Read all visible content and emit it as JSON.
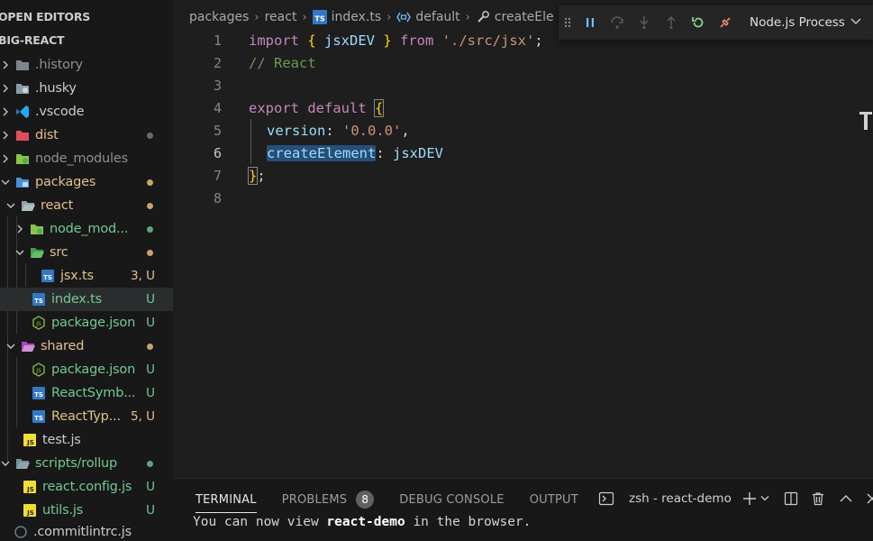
{
  "sidebar": {
    "open_editors": "OPEN EDITORS",
    "project": "BIG-REACT",
    "items": [
      {
        "label": ".history",
        "status": ""
      },
      {
        "label": ".husky",
        "status": ""
      },
      {
        "label": ".vscode",
        "status": ""
      },
      {
        "label": "dist",
        "status": ""
      },
      {
        "label": "node_modules",
        "status": ""
      },
      {
        "label": "packages",
        "status": ""
      },
      {
        "label": "react",
        "status": ""
      },
      {
        "label": "node_mod...",
        "status": ""
      },
      {
        "label": "src",
        "status": ""
      },
      {
        "label": "jsx.ts",
        "status": "3, U"
      },
      {
        "label": "index.ts",
        "status": "U"
      },
      {
        "label": "package.json",
        "status": "U"
      },
      {
        "label": "shared",
        "status": ""
      },
      {
        "label": "package.json",
        "status": "U"
      },
      {
        "label": "ReactSymb...",
        "status": "U"
      },
      {
        "label": "ReactTyp...",
        "status": "5, U"
      },
      {
        "label": "test.js",
        "status": ""
      },
      {
        "label": "scripts/rollup",
        "status": ""
      },
      {
        "label": "react.config.js",
        "status": "U"
      },
      {
        "label": "utils.js",
        "status": "U"
      },
      {
        "label": ".commitlintrc.js",
        "status": ""
      }
    ]
  },
  "breadcrumb": {
    "packages": "packages",
    "react": "react",
    "file": "index.ts",
    "symbol1": "default",
    "symbol2": "createEle"
  },
  "code": {
    "line_numbers": [
      "1",
      "2",
      "3",
      "4",
      "5",
      "6",
      "7",
      "8"
    ],
    "l1_import": "import",
    "l1_open": "{ ",
    "l1_name": "jsxDEV",
    "l1_close": " }",
    "l1_from": " from ",
    "l1_path": "'./src/jsx'",
    "l1_semi": ";",
    "l2_comment": "// React",
    "l4_export": "export",
    "l4_default": " default ",
    "l4_brace": "{",
    "l5_key": "version",
    "l5_colon": ": ",
    "l5_val": "'0.0.0'",
    "l5_comma": ",",
    "l6_key": "createElement",
    "l6_colon": ": ",
    "l6_val": "jsxDEV",
    "l7_brace": "}",
    "l7_semi": ";"
  },
  "debug": {
    "session": "Node.js Process"
  },
  "panel": {
    "tabs": [
      "TERMINAL",
      "PROBLEMS",
      "DEBUG CONSOLE",
      "OUTPUT"
    ],
    "problems_count": "8",
    "terminal_name": "zsh - react-demo",
    "line_pre": "You can now view ",
    "line_bold": "react-demo",
    "line_post": " in the browser."
  },
  "colors": {
    "accent": "#007acc",
    "ts_blue": "#3178c6",
    "js_yellow": "#f1dd35",
    "modified": "#e2c08d",
    "untracked": "#73c991"
  }
}
